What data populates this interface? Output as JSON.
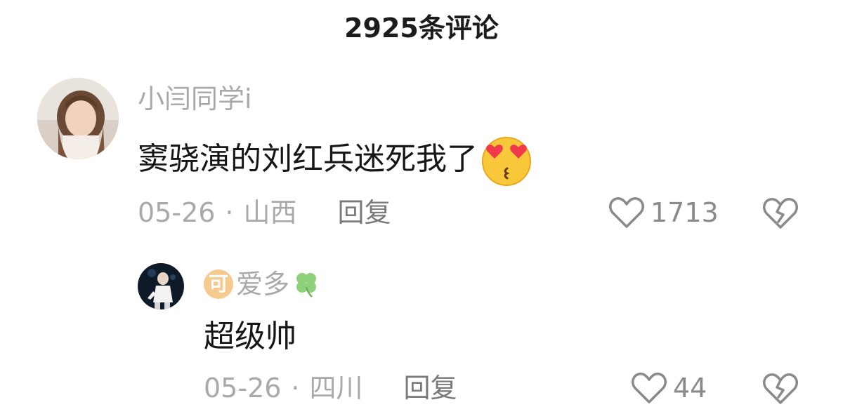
{
  "header": {
    "title": "2925条评论"
  },
  "comments": [
    {
      "username": "小闫同学i",
      "text": "窦骁演的刘红兵迷死我了",
      "emoji": "heart-eyes-kiss-emoji",
      "date": "05-26",
      "separator": "·",
      "location": "山西",
      "reply_label": "回复",
      "likes": "1713"
    },
    {
      "username": "爱多",
      "badge": "可",
      "badge_color": "#f6c98f",
      "name_icon": "four-leaf-clover-icon",
      "text": "超级帅",
      "date": "05-26",
      "separator": "·",
      "location": "四川",
      "reply_label": "回复",
      "likes": "44"
    }
  ],
  "colors": {
    "meta_gray": "#a9a9ab",
    "text_dark": "#161616",
    "reply_gray": "#7a7a7d"
  }
}
